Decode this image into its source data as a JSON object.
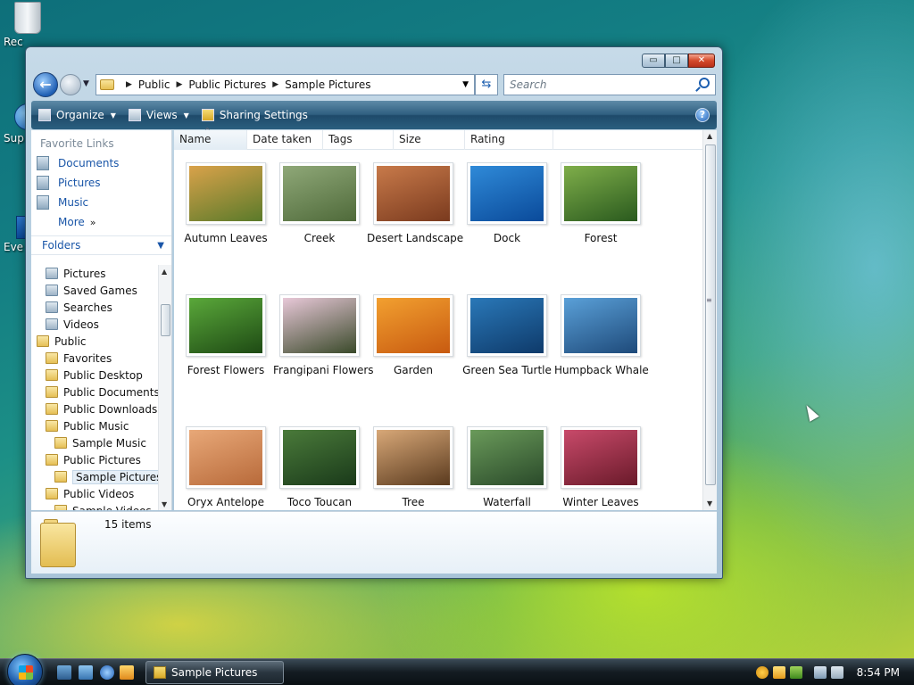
{
  "desktop": {
    "icons": [
      {
        "label": "Rec"
      },
      {
        "label": "Sup"
      },
      {
        "label": "Eve"
      }
    ]
  },
  "window": {
    "caption_buttons": {
      "minimize": "▭",
      "maximize": "□",
      "close": "✕"
    },
    "address": {
      "crumbs": [
        "Public",
        "Public Pictures",
        "Sample Pictures"
      ]
    },
    "search": {
      "placeholder": "Search"
    },
    "toolbar": {
      "organize": "Organize",
      "views": "Views",
      "sharing": "Sharing Settings",
      "help": "?"
    },
    "nav": {
      "favorite_links_header": "Favorite Links",
      "favorites": [
        "Documents",
        "Pictures",
        "Music"
      ],
      "more": "More",
      "folders_header": "Folders",
      "tree": [
        {
          "label": "Pictures",
          "indent": 1,
          "sys": true
        },
        {
          "label": "Saved Games",
          "indent": 1,
          "sys": true
        },
        {
          "label": "Searches",
          "indent": 1,
          "sys": true
        },
        {
          "label": "Videos",
          "indent": 1,
          "sys": true
        },
        {
          "label": "Public",
          "indent": 0,
          "sys": false
        },
        {
          "label": "Favorites",
          "indent": 1,
          "sys": false
        },
        {
          "label": "Public Desktop",
          "indent": 1,
          "sys": false
        },
        {
          "label": "Public Documents",
          "indent": 1,
          "sys": false
        },
        {
          "label": "Public Downloads",
          "indent": 1,
          "sys": false
        },
        {
          "label": "Public Music",
          "indent": 1,
          "sys": false
        },
        {
          "label": "Sample Music",
          "indent": 2,
          "sys": false
        },
        {
          "label": "Public Pictures",
          "indent": 1,
          "sys": false
        },
        {
          "label": "Sample Pictures",
          "indent": 2,
          "sys": false,
          "selected": true
        },
        {
          "label": "Public Videos",
          "indent": 1,
          "sys": false
        },
        {
          "label": "Sample Videos",
          "indent": 2,
          "sys": false
        }
      ]
    },
    "columns": [
      "Name",
      "Date taken",
      "Tags",
      "Size",
      "Rating"
    ],
    "items": [
      {
        "name": "Autumn Leaves",
        "colors": [
          "#d9a24a",
          "#5a7a2a"
        ]
      },
      {
        "name": "Creek",
        "colors": [
          "#8fa878",
          "#4f6a3a"
        ]
      },
      {
        "name": "Desert Landscape",
        "colors": [
          "#c87a4a",
          "#7a3a1e"
        ]
      },
      {
        "name": "Dock",
        "colors": [
          "#2f8ad8",
          "#0a4a9a"
        ]
      },
      {
        "name": "Forest",
        "colors": [
          "#7fae4a",
          "#2a5a1e"
        ]
      },
      {
        "name": "Forest Flowers",
        "colors": [
          "#5aa83a",
          "#1e4a14"
        ]
      },
      {
        "name": "Frangipani Flowers",
        "colors": [
          "#e8c8d8",
          "#3a4a2a"
        ]
      },
      {
        "name": "Garden",
        "colors": [
          "#f2a030",
          "#c85a10"
        ]
      },
      {
        "name": "Green Sea Turtle",
        "colors": [
          "#2a78b8",
          "#0e3a6a"
        ]
      },
      {
        "name": "Humpback Whale",
        "colors": [
          "#5aa0d8",
          "#1e4a7a"
        ]
      },
      {
        "name": "Oryx Antelope",
        "colors": [
          "#e8a878",
          "#b86a3a"
        ]
      },
      {
        "name": "Toco Toucan",
        "colors": [
          "#4a7a3a",
          "#1a3a1a"
        ]
      },
      {
        "name": "Tree",
        "colors": [
          "#d8a878",
          "#5a3a1e"
        ]
      },
      {
        "name": "Waterfall",
        "colors": [
          "#6a9a5a",
          "#2a4a2a"
        ]
      },
      {
        "name": "Winter Leaves",
        "colors": [
          "#c84a6a",
          "#6a1a2a"
        ]
      }
    ],
    "status": {
      "count": "15 items"
    }
  },
  "taskbar": {
    "task_label": "Sample Pictures",
    "clock": "8:54 PM"
  }
}
